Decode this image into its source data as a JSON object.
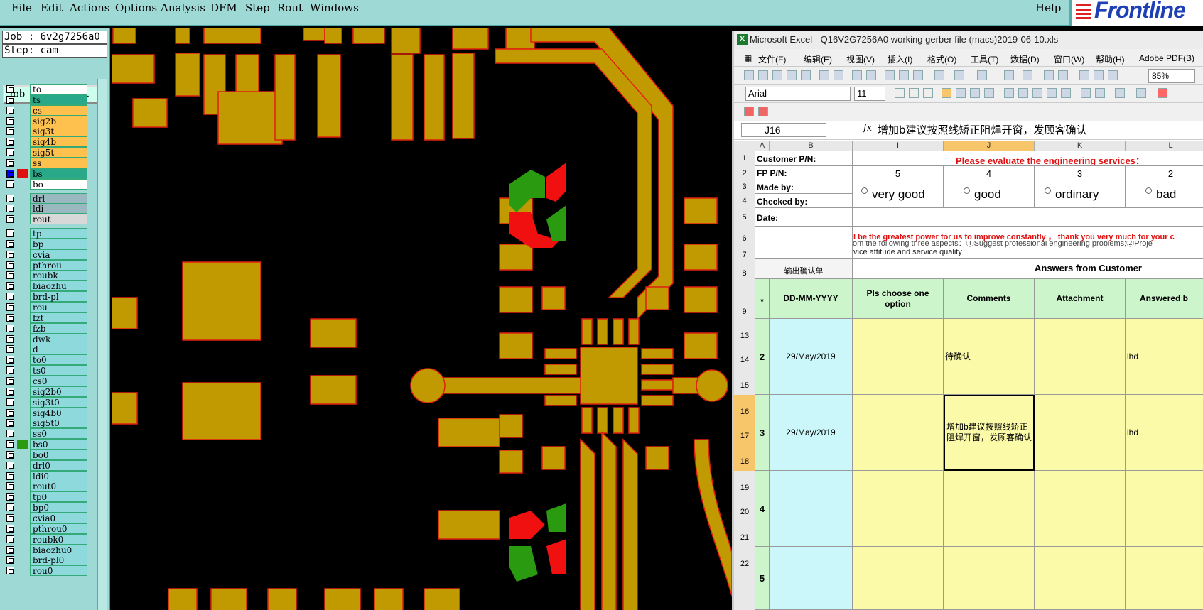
{
  "menubar": {
    "items": [
      "File",
      "Edit",
      "Actions",
      "Options",
      "Analysis",
      "DFM",
      "Step",
      "Rout",
      "Windows"
    ],
    "help": "Help",
    "logo": "Frontline"
  },
  "left_panel": {
    "job": "Job : 6v2g7256a0",
    "step": "Step: cam",
    "job_matrix": "Job Matrix ...",
    "layers": [
      {
        "name": "to",
        "color": "#ffffff"
      },
      {
        "name": "ts",
        "color": "#2aa98a"
      },
      {
        "name": "cs",
        "color": "#ffc14d"
      },
      {
        "name": "sig2b",
        "color": "#ffc14d"
      },
      {
        "name": "sig3t",
        "color": "#ffc14d"
      },
      {
        "name": "sig4b",
        "color": "#ffc14d"
      },
      {
        "name": "sig5t",
        "color": "#ffc14d"
      },
      {
        "name": "ss",
        "color": "#ffc14d"
      },
      {
        "name": "bs",
        "color": "#2aa98a"
      },
      {
        "name": "bo",
        "color": "#ffffff"
      },
      {
        "name": "drl",
        "color": "#9ab8c0"
      },
      {
        "name": "ldi",
        "color": "#9ab8c0"
      },
      {
        "name": "rout",
        "color": "#d8d8d8"
      },
      {
        "name": "tp",
        "color": "#8ed9dc"
      },
      {
        "name": "bp",
        "color": "#8ed9dc"
      },
      {
        "name": "cvia",
        "color": "#8ed9dc"
      },
      {
        "name": "pthrou",
        "color": "#8ed9dc"
      },
      {
        "name": "roubk",
        "color": "#8ed9dc"
      },
      {
        "name": "biaozhu",
        "color": "#8ed9dc"
      },
      {
        "name": "brd-pl",
        "color": "#8ed9dc"
      },
      {
        "name": "rou",
        "color": "#8ed9dc"
      },
      {
        "name": "fzt",
        "color": "#8ed9dc"
      },
      {
        "name": "fzb",
        "color": "#8ed9dc"
      },
      {
        "name": "dwk",
        "color": "#8ed9dc"
      },
      {
        "name": "d",
        "color": "#8ed9dc"
      },
      {
        "name": "to0",
        "color": "#8ed9dc"
      },
      {
        "name": "ts0",
        "color": "#8ed9dc"
      },
      {
        "name": "cs0",
        "color": "#8ed9dc"
      },
      {
        "name": "sig2b0",
        "color": "#8ed9dc"
      },
      {
        "name": "sig3t0",
        "color": "#8ed9dc"
      },
      {
        "name": "sig4b0",
        "color": "#8ed9dc"
      },
      {
        "name": "sig5t0",
        "color": "#8ed9dc"
      },
      {
        "name": "ss0",
        "color": "#8ed9dc"
      },
      {
        "name": "bs0",
        "color": "#8ed9dc"
      },
      {
        "name": "bo0",
        "color": "#8ed9dc"
      },
      {
        "name": "drl0",
        "color": "#8ed9dc"
      },
      {
        "name": "ldi0",
        "color": "#8ed9dc"
      },
      {
        "name": "rout0",
        "color": "#8ed9dc"
      },
      {
        "name": "tp0",
        "color": "#8ed9dc"
      },
      {
        "name": "bp0",
        "color": "#8ed9dc"
      },
      {
        "name": "cvia0",
        "color": "#8ed9dc"
      },
      {
        "name": "pthrou0",
        "color": "#8ed9dc"
      },
      {
        "name": "roubk0",
        "color": "#8ed9dc"
      },
      {
        "name": "biaozhu0",
        "color": "#8ed9dc"
      },
      {
        "name": "brd-pl0",
        "color": "#8ed9dc"
      },
      {
        "name": "rou0",
        "color": "#8ed9dc"
      }
    ]
  },
  "excel": {
    "title": "Microsoft Excel - Q16V2G7256A0 working gerber file (macs)2019-06-10.xls",
    "menu": [
      "文件(F)",
      "编辑(E)",
      "视图(V)",
      "插入(I)",
      "格式(O)",
      "工具(T)",
      "数据(D)",
      "窗口(W)",
      "帮助(H)",
      "Adobe PDF(B)"
    ],
    "font": "Arial",
    "font_size": "11",
    "zoom": "85%",
    "name_box": "J16",
    "formula": "增加b建议按照线矫正阻焊开窗，发顾客确认",
    "columns": [
      "A",
      "B",
      "I",
      "J",
      "K",
      "L"
    ],
    "cells": {
      "customer_pn": "Customer P/N:",
      "fp_pn": "FP P/N:",
      "made_by": "Made by:",
      "checked_by": "Checked by:",
      "date": "Date:",
      "evaluate": "Please evaluate the engineering services：",
      "score5": "5",
      "score4": "4",
      "score3": "3",
      "score2": "2",
      "opt_very_good": "very good",
      "opt_good": "good",
      "opt_ordinary": "ordinary",
      "opt_bad": "bad",
      "row6": "l be the greatest power for us to improve constantly ， thank you very much for your c",
      "row7a": "om the following three aspects：①Suggest professional engineering problems;②Proje",
      "row7b": "vice attitude and service quality",
      "output_confirm": "输出确认单",
      "answers": "Answers from Customer",
      "h_star": "*",
      "h_date": "DD-MM-YYYY",
      "h_option": "Pls choose one option",
      "h_comments": "Comments",
      "h_attachment": "Attachment",
      "h_answered": "Answered b"
    },
    "rows": [
      {
        "no": "2",
        "date": "29/May/2019",
        "comment": "待确认",
        "answered": "lhd",
        "rownums": [
          "13",
          "14",
          "15"
        ]
      },
      {
        "no": "3",
        "date": "29/May/2019",
        "comment": "增加b建议按照线矫正阻焊开窗，发顾客确认",
        "answered": "lhd",
        "rownums": [
          "16",
          "17",
          "18"
        ]
      },
      {
        "no": "4",
        "date": "",
        "comment": "",
        "answered": "",
        "rownums": [
          "19",
          "20",
          "21"
        ]
      },
      {
        "no": "5",
        "date": "",
        "comment": "",
        "answered": "",
        "rownums": [
          "22"
        ]
      }
    ]
  }
}
